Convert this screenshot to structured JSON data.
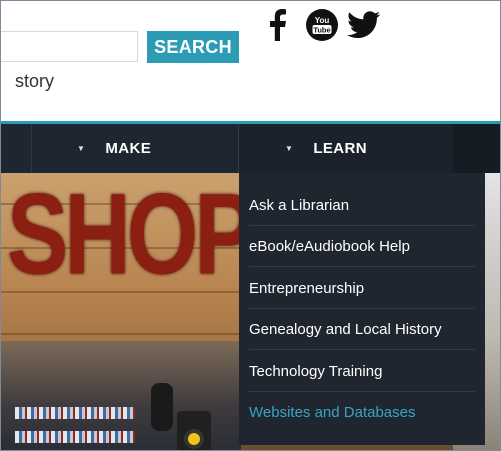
{
  "header": {
    "search_placeholder": "",
    "search_button_label": "SEARCH",
    "tagline_fragment": "story",
    "social": [
      "facebook-icon",
      "youtube-icon",
      "twitter-icon"
    ],
    "youtube_text": "You Tube"
  },
  "nav": {
    "items": [
      {
        "label": "MAKE"
      },
      {
        "label": "LEARN"
      }
    ]
  },
  "hero": {
    "sign_text": "SHOPS"
  },
  "dropdown": {
    "items": [
      {
        "label": "Ask a Librarian"
      },
      {
        "label": "eBook/eAudiobook Help"
      },
      {
        "label": "Entrepreneurship"
      },
      {
        "label": "Genealogy and Local History"
      },
      {
        "label": "Technology Training"
      },
      {
        "label": "Websites and Databases"
      }
    ],
    "active_color": "#3aa3c4"
  },
  "colors": {
    "accent": "#2c9cb4",
    "nav_bg": "#1e2631",
    "dropdown_bg": "#1f2630"
  }
}
